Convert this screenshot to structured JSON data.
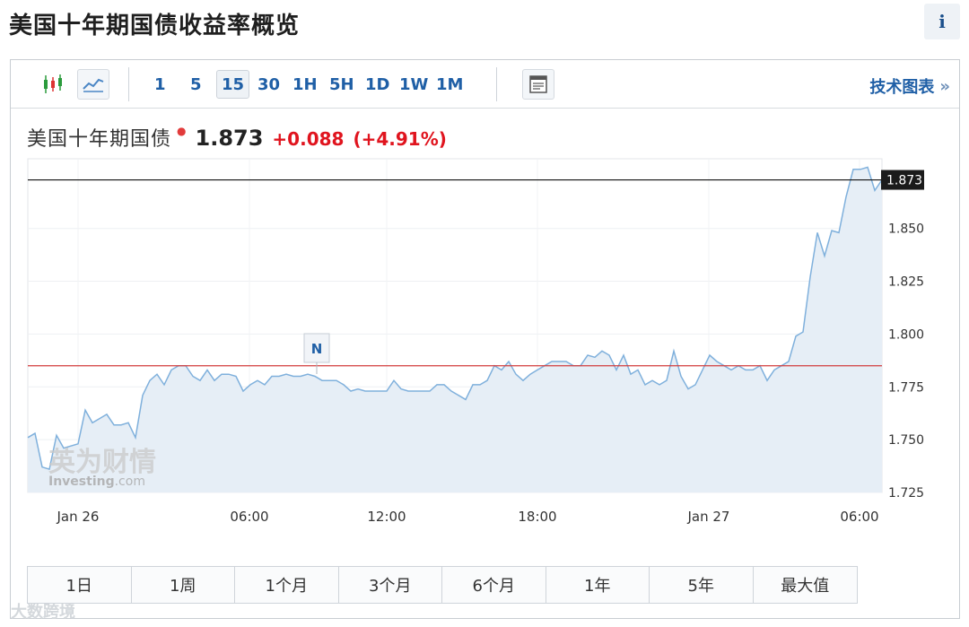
{
  "page": {
    "title": "美国十年期国债收益率概览",
    "info_label": "i"
  },
  "toolbar": {
    "intervals": [
      "1",
      "5",
      "15",
      "30",
      "1H",
      "5H",
      "1D",
      "1W",
      "1M"
    ],
    "active_interval": "15",
    "technical_chart_label": "技术图表",
    "technical_chart_arrows": "»",
    "icons": [
      "candlestick-chart-icon",
      "line-chart-icon",
      "news-layout-icon"
    ]
  },
  "quote": {
    "name": "美国十年期国债",
    "price": "1.873",
    "change": "+0.088",
    "change_pct": "(+4.91%)"
  },
  "chart_data": {
    "type": "area",
    "ylim": [
      1.725,
      1.883
    ],
    "y_ticks": [
      "1.725",
      "1.750",
      "1.775",
      "1.800",
      "1.825",
      "1.850"
    ],
    "x_ticks": [
      "Jan 26",
      "06:00",
      "12:00",
      "18:00",
      "Jan 27",
      "06:00"
    ],
    "last_price_label": "1.873",
    "last_price": 1.873,
    "previous_close": 1.785,
    "news_marker": "N",
    "watermark_cn": "英为财情",
    "watermark_en": "Investing",
    "watermark_suffix": ".com",
    "series": [
      {
        "values": [
          1.751,
          1.753,
          1.737,
          1.736,
          1.752,
          1.746,
          1.747,
          1.748,
          1.764,
          1.758,
          1.76,
          1.762,
          1.757,
          1.757,
          1.758,
          1.751,
          1.771,
          1.778,
          1.781,
          1.776,
          1.783,
          1.785,
          1.785,
          1.78,
          1.778,
          1.783,
          1.778,
          1.781,
          1.781,
          1.78,
          1.773,
          1.776,
          1.778,
          1.776,
          1.78,
          1.78,
          1.781,
          1.78,
          1.78,
          1.781,
          1.78,
          1.778,
          1.778,
          1.778,
          1.776,
          1.773,
          1.774,
          1.773,
          1.773,
          1.773,
          1.773,
          1.778,
          1.774,
          1.773,
          1.773,
          1.773,
          1.773,
          1.776,
          1.776,
          1.773,
          1.771,
          1.769,
          1.776,
          1.776,
          1.778,
          1.785,
          1.783,
          1.787,
          1.781,
          1.778,
          1.781,
          1.783,
          1.785,
          1.787,
          1.787,
          1.787,
          1.785,
          1.785,
          1.79,
          1.789,
          1.792,
          1.79,
          1.783,
          1.79,
          1.781,
          1.783,
          1.776,
          1.778,
          1.776,
          1.778,
          1.792,
          1.78,
          1.774,
          1.776,
          1.783,
          1.79,
          1.787,
          1.785,
          1.783,
          1.785,
          1.783,
          1.783,
          1.785,
          1.778,
          1.783,
          1.785,
          1.787,
          1.799,
          1.801,
          1.827,
          1.848,
          1.837,
          1.849,
          1.848,
          1.865,
          1.878,
          1.878,
          1.879,
          1.868,
          1.873
        ]
      }
    ]
  },
  "ranges": [
    "1日",
    "1周",
    "1个月",
    "3个月",
    "6个月",
    "1年",
    "5年",
    "最大值"
  ],
  "footer_watermark": "大数跨境",
  "colors": {
    "line": "#7fb0dc",
    "fill": "#e6eef6",
    "prev_close": "#d23c3c",
    "last_price": "#111111",
    "up": "#e0141e",
    "link": "#1f5fa6"
  }
}
